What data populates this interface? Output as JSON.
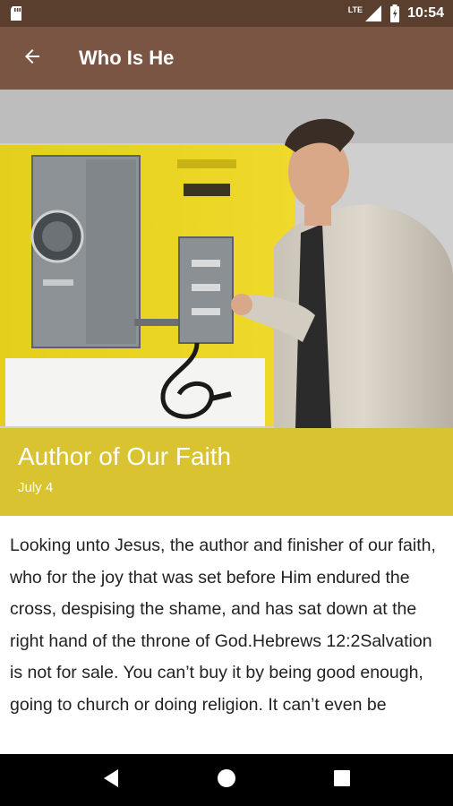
{
  "status_bar": {
    "time": "10:54",
    "network_label": "LTE",
    "icons": [
      "sd-card-icon",
      "signal-icon",
      "battery-icon"
    ]
  },
  "app_bar": {
    "title": "Who Is He",
    "back_icon": "arrow-back-icon"
  },
  "article": {
    "title": "Author of Our Faith",
    "date": "July 4",
    "body": " Looking unto Jesus, the author and finisher of our faith, who for the joy that was set before Him endured the cross, despising the shame, and has sat down at the right hand of the throne of God.Hebrews 12:2Salvation is not for sale. You can’t buy it by being good enough, going to church or doing religion. It can’t even be"
  },
  "nav_bar": {
    "icons": [
      "back-triangle-icon",
      "home-circle-icon",
      "recents-square-icon"
    ]
  },
  "colors": {
    "status_bar": "#5b3f2e",
    "app_bar": "#7a5544",
    "title_block": "#d9c330",
    "nav_bar": "#000000"
  }
}
